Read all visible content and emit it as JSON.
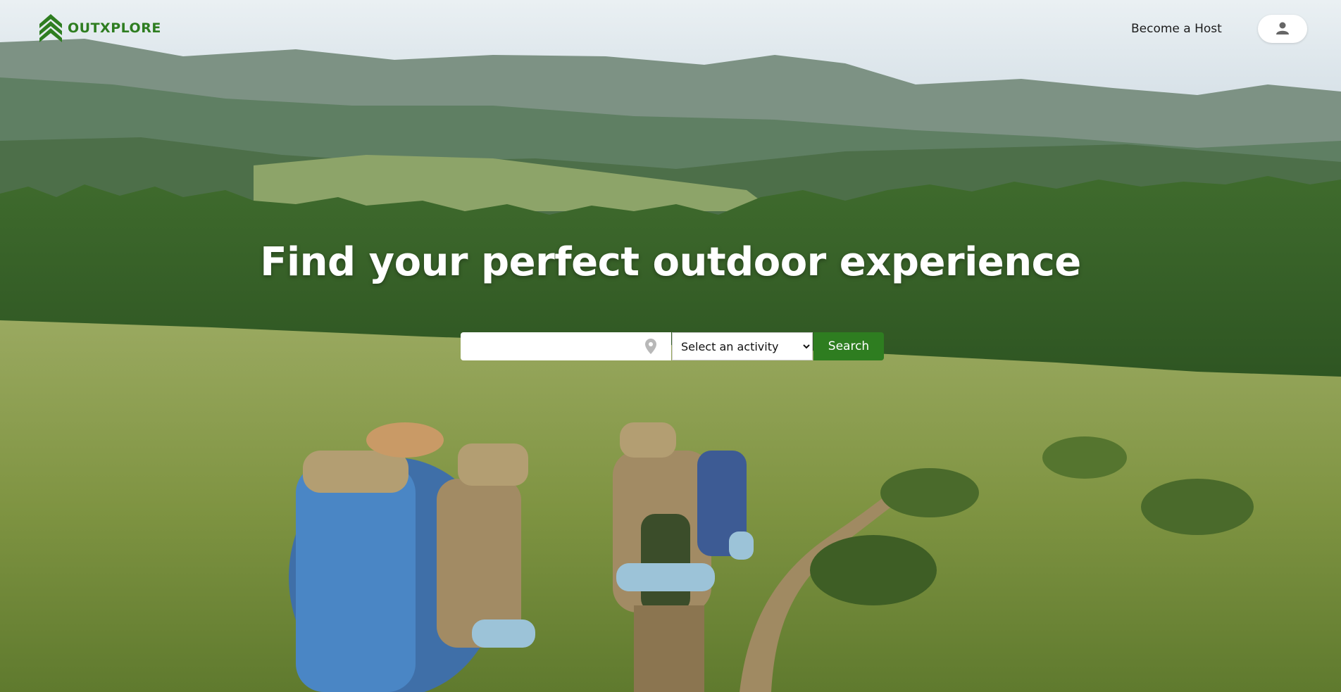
{
  "brand": {
    "name": "OUTXPLORE",
    "logo_icon": "double-chevron-up-icon",
    "color": "#2e7d20"
  },
  "header": {
    "host_link_label": "Become a Host",
    "profile_icon": "user-icon"
  },
  "hero": {
    "headline": "Find your perfect outdoor experience",
    "image_description": "hikers with backpacks walking on a trail through a green meadow toward forest and mountains"
  },
  "search": {
    "location_placeholder": "",
    "location_icon": "map-pin-icon",
    "activity_selected": "Select an activity",
    "activity_options": [
      "Select an activity"
    ],
    "button_label": "Search"
  },
  "colors": {
    "accent": "#2e7d20",
    "headline_text": "#ffffff",
    "header_text": "#1d1d1d"
  }
}
